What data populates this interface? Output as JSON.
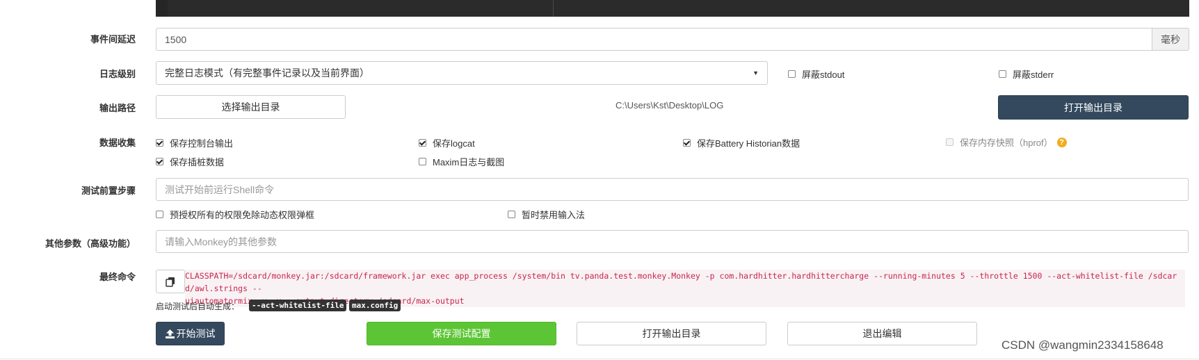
{
  "labels": {
    "delay": "事件间延迟",
    "log_level": "日志级别",
    "output_path": "输出路径",
    "data_collect": "数据收集",
    "pre_steps": "测试前置步骤",
    "other_params": "其他参数（高级功能）",
    "final_cmd": "最终命令"
  },
  "delay": {
    "value": "1500",
    "unit": "毫秒"
  },
  "log_level": {
    "selected": "完整日志模式（有完整事件记录以及当前界面）",
    "hide_stdout": {
      "label": "屏蔽stdout",
      "checked": false
    },
    "hide_stderr": {
      "label": "屏蔽stderr",
      "checked": false
    }
  },
  "output": {
    "choose_button": "选择输出目录",
    "path": "C:\\Users\\Kst\\Desktop\\LOG",
    "open_button": "打开输出目录"
  },
  "collect": [
    {
      "label": "保存控制台输出",
      "checked": true
    },
    {
      "label": "保存logcat",
      "checked": true
    },
    {
      "label": "保存Battery Historian数据",
      "checked": true
    },
    {
      "label": "保存内存快照（hprof）",
      "checked": false,
      "disabled": true
    },
    {
      "label": "保存插桩数据",
      "checked": true
    },
    {
      "label": "Maxim日志与截图",
      "checked": false
    }
  ],
  "pre_steps": {
    "placeholder": "测试开始前运行Shell命令",
    "grant_permissions": {
      "label": "预授权所有的权限免除动态权限弹框",
      "checked": false
    },
    "disable_ime": {
      "label": "暂时禁用输入法",
      "checked": false
    }
  },
  "other_params": {
    "placeholder": "请输入Monkey的其他参数"
  },
  "final_cmd": {
    "line1": "CLASSPATH=/sdcard/monkey.jar:/sdcard/framework.jar exec app_process /system/bin tv.panda.test.monkey.Monkey -p com.hardhitter.hardhittercharge --running-minutes 5 --throttle 1500 --act-whitelist-file /sdcard/awl.strings --",
    "line2": "uiautomatormix -v -v --output-directory /sdcard/max-output",
    "auto_gen_label": "启动测试后自动生成：",
    "tag1": "--act-whitelist-file",
    "tag2": "max.config"
  },
  "actions": {
    "start": "开始测试",
    "save": "保存测试配置",
    "open_dir": "打开输出目录",
    "exit": "退出编辑"
  },
  "watermark": "CSDN @wangmin2334158648",
  "colors": {
    "dark_button": "#34495e",
    "green_button": "#5cc535",
    "command_text": "#c7254e",
    "help_icon": "#f0ad1e"
  },
  "icons": {
    "copy": "copy-icon",
    "upload": "upload-icon",
    "help": "question-icon",
    "dropdown": "caret-down-icon"
  }
}
